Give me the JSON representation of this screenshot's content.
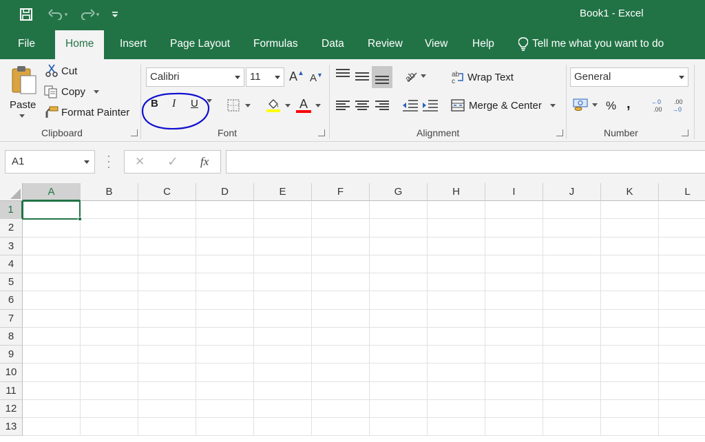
{
  "window": {
    "title": "Book1  -  Excel"
  },
  "qat": {
    "save_icon": "save-icon",
    "undo_icon": "undo-icon",
    "redo_icon": "redo-icon",
    "customize_icon": "customize-qat-icon"
  },
  "menu": {
    "tabs": [
      {
        "label": "File"
      },
      {
        "label": "Home"
      },
      {
        "label": "Insert"
      },
      {
        "label": "Page Layout"
      },
      {
        "label": "Formulas"
      },
      {
        "label": "Data"
      },
      {
        "label": "Review"
      },
      {
        "label": "View"
      },
      {
        "label": "Help"
      }
    ],
    "active_tab": "Home",
    "tell_me": "Tell me what you want to do"
  },
  "clipboard": {
    "paste": "Paste",
    "cut": "Cut",
    "copy": "Copy",
    "format_painter": "Format Painter",
    "label": "Clipboard"
  },
  "font": {
    "name": "Calibri",
    "size": "11",
    "bold": "B",
    "italic": "I",
    "underline": "U",
    "font_color_glyph": "A",
    "label": "Font"
  },
  "alignment": {
    "wrap_text": "Wrap Text",
    "merge_center": "Merge & Center",
    "label": "Alignment"
  },
  "number": {
    "format": "General",
    "percent": "%",
    "comma": ",",
    "label": "Number"
  },
  "formula_bar": {
    "name_box": "A1",
    "cancel": "✕",
    "enter": "✓",
    "fx": "fx",
    "value": ""
  },
  "sheet": {
    "columns": [
      "A",
      "B",
      "C",
      "D",
      "E",
      "F",
      "G",
      "H",
      "I",
      "J",
      "K",
      "L"
    ],
    "rows": [
      "1",
      "2",
      "3",
      "4",
      "5",
      "6",
      "7",
      "8",
      "9",
      "10",
      "11",
      "12",
      "13"
    ],
    "selected_cell": "A1"
  },
  "colors": {
    "accent": "#217346",
    "annotation": "#1010d0",
    "fill_yellow": "#ffff00",
    "font_red": "#ff0000"
  }
}
